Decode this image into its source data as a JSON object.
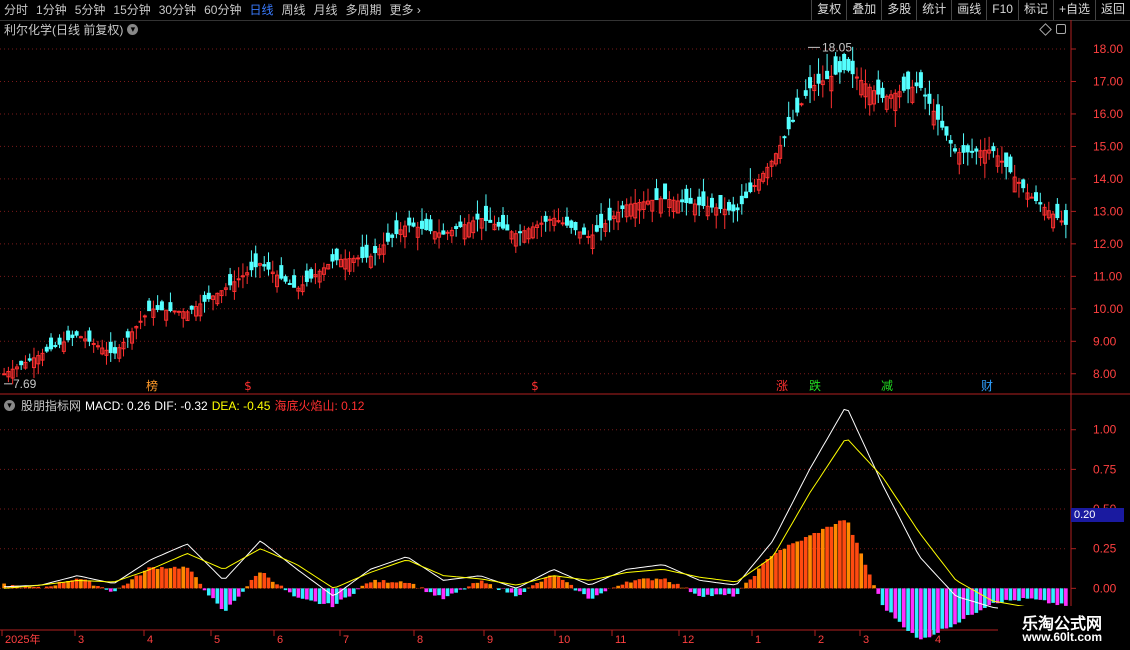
{
  "toolbar": {
    "periods": [
      "分时",
      "1分钟",
      "5分钟",
      "15分钟",
      "30分钟",
      "60分钟",
      "日线",
      "周线",
      "月线",
      "多周期",
      "更多"
    ],
    "active_index": 6,
    "more_arrow": "›",
    "right_buttons": [
      "复权",
      "叠加",
      "多股",
      "统计",
      "画线",
      "F10",
      "标记",
      "+自选",
      "返回"
    ]
  },
  "kline": {
    "title": "利尔化学(日线 前复权)",
    "high_label": "18.05",
    "low_label": "7.69",
    "price_ticks": [
      "18.00",
      "17.00",
      "16.00",
      "15.00",
      "14.00",
      "13.00",
      "12.00",
      "11.00",
      "10.00",
      "9.00",
      "8.00"
    ],
    "signals": [
      {
        "text": "榜",
        "color": "#ff9a2a"
      },
      {
        "text": "$",
        "color": "#ff3030"
      },
      {
        "text": "$",
        "color": "#ff3030"
      },
      {
        "text": "涨",
        "color": "#ff3030"
      },
      {
        "text": "跌",
        "color": "#22dd22"
      },
      {
        "text": "减",
        "color": "#22dd22"
      },
      {
        "text": "财",
        "color": "#30a0ff"
      }
    ]
  },
  "macd": {
    "name": "股朋指标网",
    "macd_text": "MACD: 0.26",
    "dif_text": "DIF: -0.32",
    "dea_text": "DEA: -0.45",
    "extra_text": "海底火焰山: 0.12",
    "ticks": [
      "1.00",
      "0.75",
      "0.50",
      "0.25",
      "0.00"
    ],
    "current_value": "0.20"
  },
  "time_axis": {
    "labels": [
      "2025年",
      "3",
      "4",
      "5",
      "6",
      "7",
      "8",
      "9",
      "10",
      "11",
      "12",
      "1",
      "2",
      "3",
      "4"
    ]
  },
  "watermark": {
    "main": "乐淘公式网",
    "sub": "www.60lt.com"
  },
  "colors": {
    "up": "#ff3030",
    "down": "#54ffff",
    "grid": "#7a1a1a",
    "axis": "#b02020",
    "dif": "#ffffff",
    "dea": "#ffff00",
    "hist_pos_dark": "#ff4a10",
    "hist_pos_light": "#ff8a00",
    "hist_neg": "#ff30ff",
    "hist_neg_alt": "#30f0ff"
  },
  "chart_data": [
    {
      "type": "candlestick",
      "title": "利尔化学(日线 前复权)",
      "ylim": [
        7.5,
        18.4
      ],
      "y_ticks": [
        8,
        9,
        10,
        11,
        12,
        13,
        14,
        15,
        16,
        17,
        18
      ],
      "annotations": [
        {
          "text": "18.05",
          "y": 18.05
        },
        {
          "text": "7.69",
          "y": 7.69
        }
      ],
      "close_approx": [
        {
          "x": "2025-02",
          "y": 8.0
        },
        {
          "x": "2025-03",
          "y": 8.6
        },
        {
          "x": "2025-03-mid",
          "y": 9.2
        },
        {
          "x": "2025-04",
          "y": 8.6
        },
        {
          "x": "2025-04-mid",
          "y": 10.0
        },
        {
          "x": "2025-05",
          "y": 9.9
        },
        {
          "x": "2025-05-mid",
          "y": 10.6
        },
        {
          "x": "2025-06",
          "y": 11.4
        },
        {
          "x": "2025-06-mid",
          "y": 10.6
        },
        {
          "x": "2025-07",
          "y": 11.5
        },
        {
          "x": "2025-07-mid",
          "y": 11.6
        },
        {
          "x": "2025-08",
          "y": 12.6
        },
        {
          "x": "2025-08-mid",
          "y": 12.3
        },
        {
          "x": "2025-09",
          "y": 12.8
        },
        {
          "x": "2025-09-mid",
          "y": 12.3
        },
        {
          "x": "2025-10",
          "y": 12.8
        },
        {
          "x": "2025-10-mid",
          "y": 12.2
        },
        {
          "x": "2025-11",
          "y": 13.2
        },
        {
          "x": "2025-11-mid",
          "y": 13.4
        },
        {
          "x": "2025-12",
          "y": 13.2
        },
        {
          "x": "2025-12-mid",
          "y": 13.0
        },
        {
          "x": "2026-01",
          "y": 14.6
        },
        {
          "x": "2026-01-mid",
          "y": 16.8
        },
        {
          "x": "2026-02",
          "y": 17.4
        },
        {
          "x": "2026-02-mid",
          "y": 16.5
        },
        {
          "x": "2026-03",
          "y": 16.9
        },
        {
          "x": "2026-03-mid",
          "y": 14.8
        },
        {
          "x": "2026-04",
          "y": 14.9
        },
        {
          "x": "2026-04-mid",
          "y": 13.5
        },
        {
          "x": "2026-05",
          "y": 12.6
        }
      ]
    },
    {
      "type": "line",
      "title": "股朋指标网",
      "ylim": [
        -0.25,
        1.2
      ],
      "y_ticks": [
        0,
        0.25,
        0.5,
        0.75,
        1.0
      ],
      "series": [
        {
          "name": "DIF",
          "values": [
            0.01,
            0.02,
            0.08,
            0.03,
            0.18,
            0.28,
            0.05,
            0.3,
            0.12,
            -0.05,
            0.12,
            0.2,
            0.05,
            0.08,
            0.0,
            0.12,
            0.02,
            0.12,
            0.15,
            0.05,
            0.02,
            0.3,
            0.75,
            1.15,
            0.65,
            0.2,
            -0.05,
            -0.12,
            -0.15,
            -0.25
          ]
        },
        {
          "name": "DEA",
          "values": [
            0.0,
            0.02,
            0.05,
            0.04,
            0.12,
            0.22,
            0.12,
            0.25,
            0.15,
            0.0,
            0.1,
            0.18,
            0.08,
            0.06,
            0.02,
            0.08,
            0.05,
            0.1,
            0.12,
            0.07,
            0.04,
            0.2,
            0.6,
            0.95,
            0.7,
            0.35,
            0.05,
            -0.08,
            -0.12,
            -0.2
          ]
        }
      ],
      "labels": {
        "MACD": 0.26,
        "DIF": -0.32,
        "DEA": -0.45,
        "海底火焰山": 0.12
      }
    }
  ]
}
